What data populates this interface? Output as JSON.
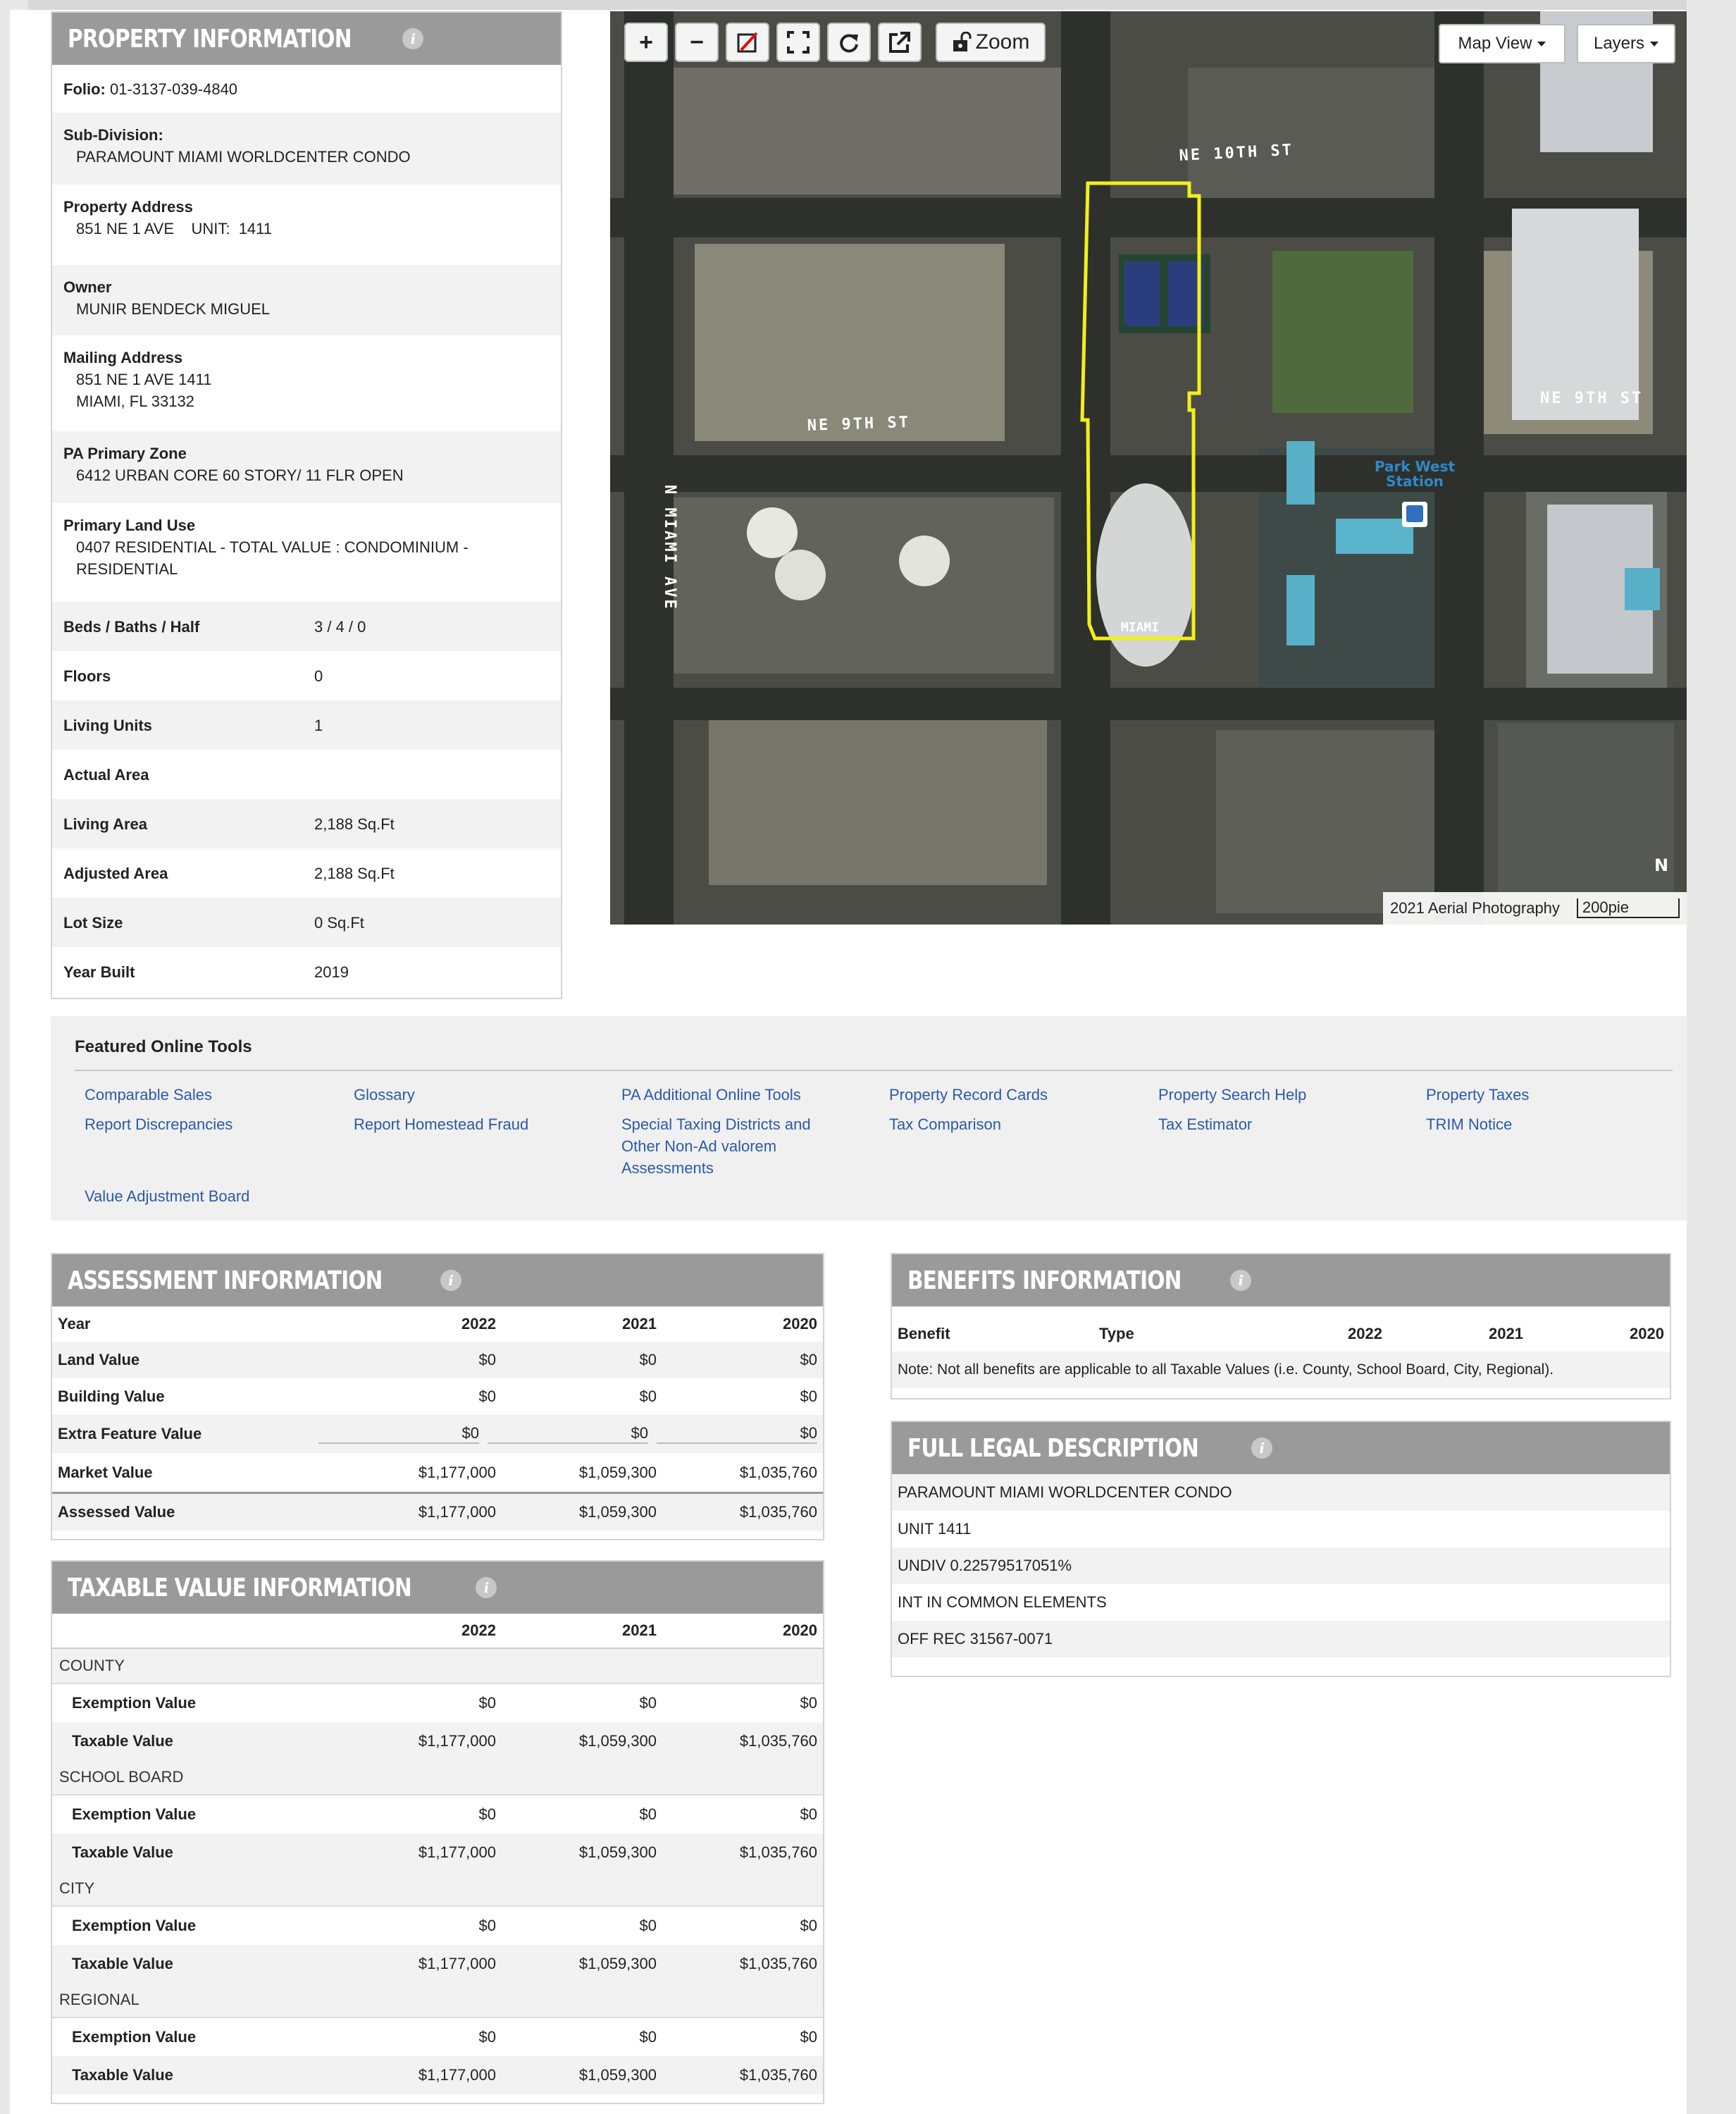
{
  "property": {
    "title": "PROPERTY INFORMATION",
    "folio_label": "Folio:",
    "folio": "01-3137-039-4840",
    "subdivision_label": "Sub-Division:",
    "subdivision": "PARAMOUNT MIAMI WORLDCENTER CONDO",
    "address_label": "Property Address",
    "address": "851 NE 1 AVE    UNIT:  1411",
    "owner_label": "Owner",
    "owner": "MUNIR BENDECK MIGUEL",
    "mailing_label": "Mailing Address",
    "mailing_line1": "851 NE 1 AVE 1411",
    "mailing_line2": "MIAMI, FL 33132",
    "zone_label": "PA Primary Zone",
    "zone": "6412 URBAN CORE 60 STORY/ 11 FLR OPEN",
    "landuse_label": "Primary Land Use",
    "landuse_line1": "0407 RESIDENTIAL - TOTAL VALUE : CONDOMINIUM -",
    "landuse_line2": "RESIDENTIAL",
    "facts": [
      {
        "label": "Beds / Baths / Half",
        "value": "3 / 4 / 0"
      },
      {
        "label": "Floors",
        "value": "0"
      },
      {
        "label": "Living Units",
        "value": "1"
      },
      {
        "label": "Actual Area",
        "value": ""
      },
      {
        "label": "Living Area",
        "value": "2,188 Sq.Ft"
      },
      {
        "label": "Adjusted Area",
        "value": "2,188 Sq.Ft"
      },
      {
        "label": "Lot Size",
        "value": "0 Sq.Ft"
      },
      {
        "label": "Year Built",
        "value": "2019"
      }
    ]
  },
  "map": {
    "zoom_label": "Zoom",
    "map_view_label": "Map View",
    "layers_label": "Layers",
    "attribution": "2021 Aerial Photography",
    "scale_label": "200pie",
    "street_labels": [
      "NE 10TH ST",
      "NE 9TH ST",
      "NE 9TH ST",
      "N MIAMI AVE"
    ],
    "station_label_1": "Park West",
    "station_label_2": "Station",
    "building_label": "MIAMI",
    "north_label": "N"
  },
  "tools": {
    "heading": "Featured Online Tools",
    "links": [
      "Comparable Sales",
      "Report Discrepancies",
      "Glossary",
      "Report Homestead Fraud",
      "PA Additional Online Tools",
      "Special Taxing Districts and",
      "Other Non-Ad valorem",
      "Assessments",
      "Property Record Cards",
      "Tax Comparison",
      "Property Search Help",
      "Tax Estimator",
      "Property Taxes",
      "TRIM Notice",
      "Value Adjustment Board"
    ]
  },
  "assessment": {
    "title": "ASSESSMENT INFORMATION",
    "header": [
      "Year",
      "2022",
      "2021",
      "2020"
    ],
    "rows": [
      [
        "Land Value",
        "$0",
        "$0",
        "$0"
      ],
      [
        "Building Value",
        "$0",
        "$0",
        "$0"
      ],
      [
        "Extra Feature Value",
        "$0",
        "$0",
        "$0"
      ],
      [
        "Market Value",
        "$1,177,000",
        "$1,059,300",
        "$1,035,760"
      ],
      [
        "Assessed Value",
        "$1,177,000",
        "$1,059,300",
        "$1,035,760"
      ]
    ]
  },
  "taxable": {
    "title": "TAXABLE VALUE INFORMATION",
    "years": [
      "2022",
      "2021",
      "2020"
    ],
    "sections": [
      {
        "name": "COUNTY",
        "rows": [
          [
            "Exemption Value",
            "$0",
            "$0",
            "$0"
          ],
          [
            "Taxable Value",
            "$1,177,000",
            "$1,059,300",
            "$1,035,760"
          ]
        ]
      },
      {
        "name": "SCHOOL BOARD",
        "rows": [
          [
            "Exemption Value",
            "$0",
            "$0",
            "$0"
          ],
          [
            "Taxable Value",
            "$1,177,000",
            "$1,059,300",
            "$1,035,760"
          ]
        ]
      },
      {
        "name": "CITY",
        "rows": [
          [
            "Exemption Value",
            "$0",
            "$0",
            "$0"
          ],
          [
            "Taxable Value",
            "$1,177,000",
            "$1,059,300",
            "$1,035,760"
          ]
        ]
      },
      {
        "name": "REGIONAL",
        "rows": [
          [
            "Exemption Value",
            "$0",
            "$0",
            "$0"
          ],
          [
            "Taxable Value",
            "$1,177,000",
            "$1,059,300",
            "$1,035,760"
          ]
        ]
      }
    ]
  },
  "benefits": {
    "title": "BENEFITS INFORMATION",
    "header": [
      "Benefit",
      "Type",
      "2022",
      "2021",
      "2020"
    ],
    "note": "Note: Not all benefits are applicable to all Taxable Values (i.e. County, School Board, City, Regional)."
  },
  "legal": {
    "title": "FULL LEGAL DESCRIPTION",
    "lines": [
      "PARAMOUNT MIAMI WORLDCENTER CONDO",
      "UNIT 1411",
      "UNDIV 0.22579517051%",
      "INT IN COMMON ELEMENTS",
      "OFF REC 31567-0071"
    ]
  },
  "colors": {
    "header_bg": "#9a9a9a",
    "link": "#2b5aa6",
    "parcel_outline": "#f2ef1a"
  }
}
